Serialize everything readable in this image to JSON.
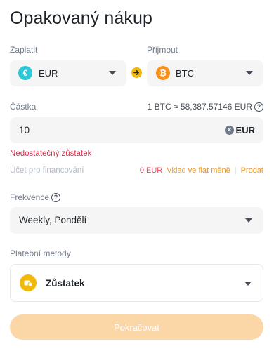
{
  "page": {
    "title": "Opakovaný nákup"
  },
  "pay": {
    "label": "Zaplatit",
    "currency": "EUR",
    "coin_symbol": "€",
    "coin_color": "#2bc8d8"
  },
  "receive": {
    "label": "Přijmout",
    "currency": "BTC",
    "coin_symbol": "₿",
    "coin_color": "#f7931a"
  },
  "amount": {
    "label": "Částka",
    "rate": "1 BTC ≈ 58,387.57146 EUR",
    "value": "10",
    "currency": "EUR",
    "error": "Nedostatečný zůstatek"
  },
  "funding": {
    "label": "Účet pro financování",
    "amount": "0 EUR",
    "deposit_link": "Vklad ve fiat měně",
    "sell_link": "Prodat"
  },
  "frequency": {
    "label": "Frekvence",
    "value": "Weekly, Pondělí"
  },
  "payment_method": {
    "label": "Platební metody",
    "value": "Zůstatek"
  },
  "actions": {
    "continue_label": "Pokračovat"
  },
  "colors": {
    "accent": "#f0b90b",
    "error": "#d9304e",
    "link": "#e8962c",
    "button_disabled": "#fbd7a8"
  }
}
